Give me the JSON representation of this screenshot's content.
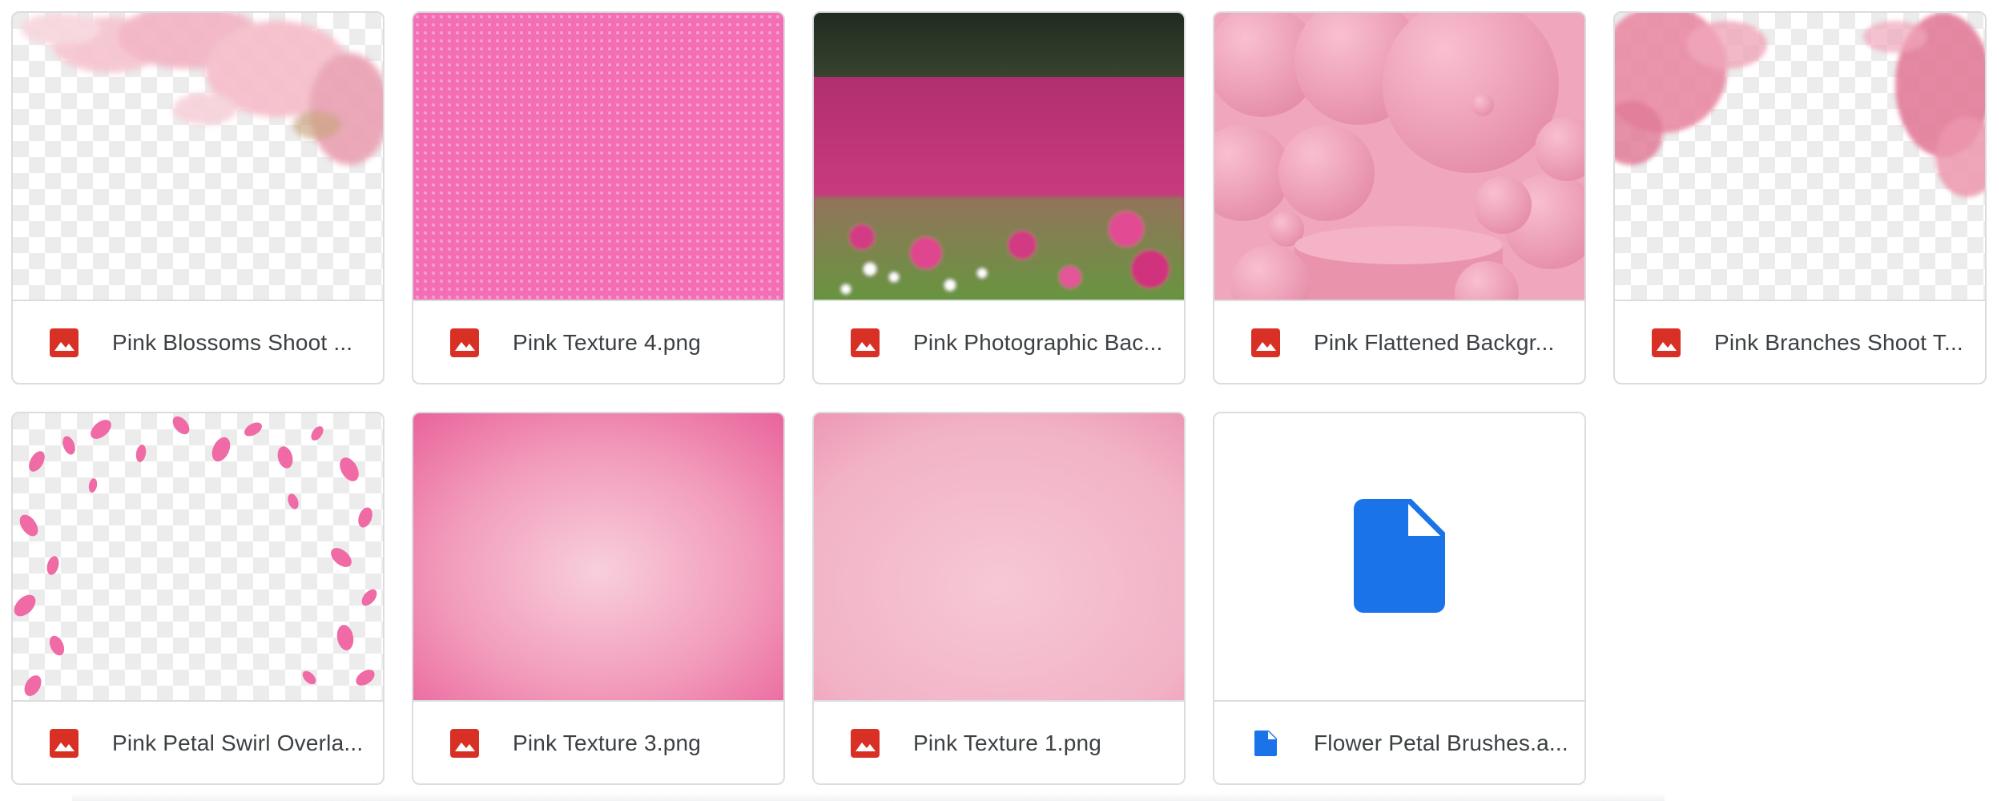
{
  "files": [
    {
      "name": "Pink Blossoms Shoot ...",
      "type": "image",
      "icon": "image-file-icon",
      "thumbnail": "pink-blossoms-transparent-overlay"
    },
    {
      "name": "Pink Texture 4.png",
      "type": "image",
      "icon": "image-file-icon",
      "thumbnail": "pink-dotted-texture"
    },
    {
      "name": "Pink Photographic Bac...",
      "type": "image",
      "icon": "image-file-icon",
      "thumbnail": "pink-flower-field-photo"
    },
    {
      "name": "Pink Flattened Backgr...",
      "type": "image",
      "icon": "image-file-icon",
      "thumbnail": "pink-spheres-podium-3d"
    },
    {
      "name": "Pink Branches Shoot T...",
      "type": "image",
      "icon": "image-file-icon",
      "thumbnail": "pink-branches-transparent-overlay"
    },
    {
      "name": "Pink Petal Swirl Overla...",
      "type": "image",
      "icon": "image-file-icon",
      "thumbnail": "pink-petal-swirl-transparent-overlay"
    },
    {
      "name": "Pink Texture 3.png",
      "type": "image",
      "icon": "image-file-icon",
      "thumbnail": "pink-watercolor-texture"
    },
    {
      "name": "Pink Texture 1.png",
      "type": "image",
      "icon": "image-file-icon",
      "thumbnail": "light-pink-paper-texture"
    },
    {
      "name": "Flower Petal Brushes.a...",
      "type": "file",
      "icon": "generic-file-icon",
      "thumbnail": "blue-document-icon"
    }
  ],
  "colors": {
    "image_icon": "#d93025",
    "file_icon": "#1a73e8",
    "border": "#dadce0",
    "text": "#3c4043"
  }
}
